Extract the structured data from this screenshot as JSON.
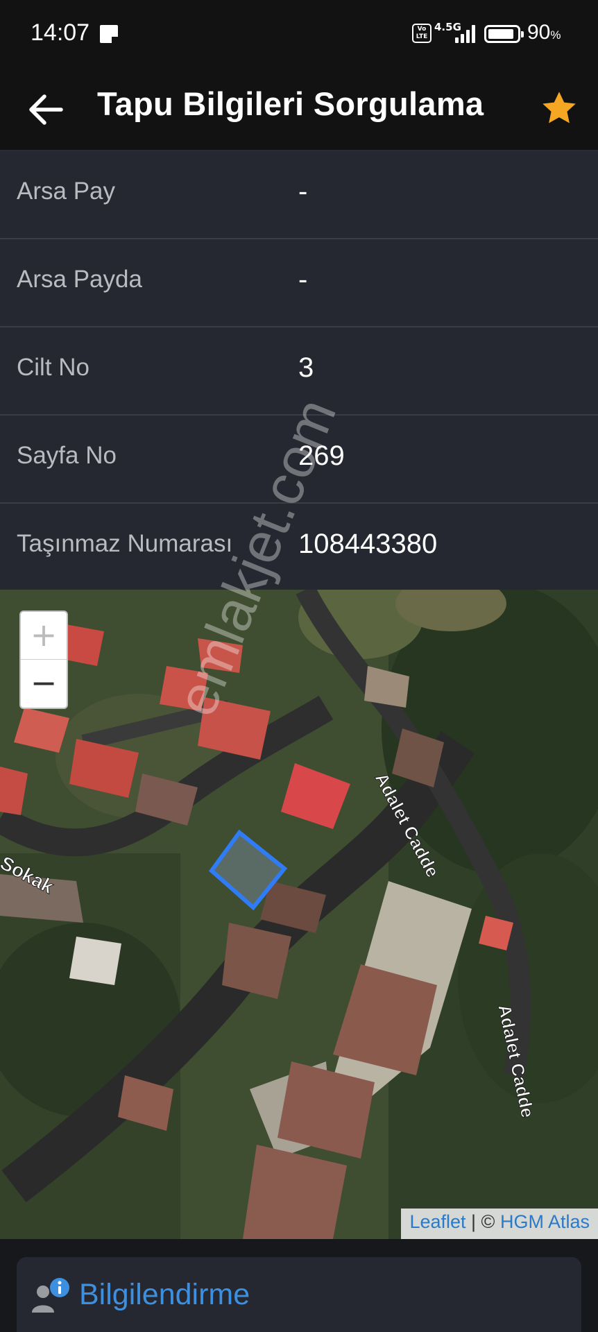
{
  "status_bar": {
    "time": "14:07",
    "network": "4.5G",
    "volte": "Vo LTE",
    "battery_percent": "90",
    "battery_symbol": "%",
    "battery_level": 0.9
  },
  "header": {
    "title": "Tapu Bilgileri Sorgulama",
    "back_icon": "arrow-left-icon",
    "favorite_icon": "star-icon",
    "favorite_color": "#f5a623"
  },
  "details": [
    {
      "label": "Arsa Pay",
      "value": "-"
    },
    {
      "label": "Arsa Payda",
      "value": "-"
    },
    {
      "label": "Cilt No",
      "value": "3"
    },
    {
      "label": "Sayfa No",
      "value": "269"
    },
    {
      "label": "Taşınmaz Numarası",
      "value": "108443380"
    }
  ],
  "map": {
    "zoom_in": "+",
    "zoom_out": "−",
    "street_labels": [
      "Adalet Cadde",
      "Adalet Cadde",
      "Sokak"
    ],
    "attribution_link": "Leaflet",
    "attribution_separator": "| ©",
    "attribution_source": "HGM Atlas",
    "parcel_color": "#2f7cf6"
  },
  "watermark": "emlakjet.com",
  "info_card": {
    "icon": "user-info-icon",
    "title": "Bilgilendirme",
    "accent": "#3d8fe0"
  }
}
